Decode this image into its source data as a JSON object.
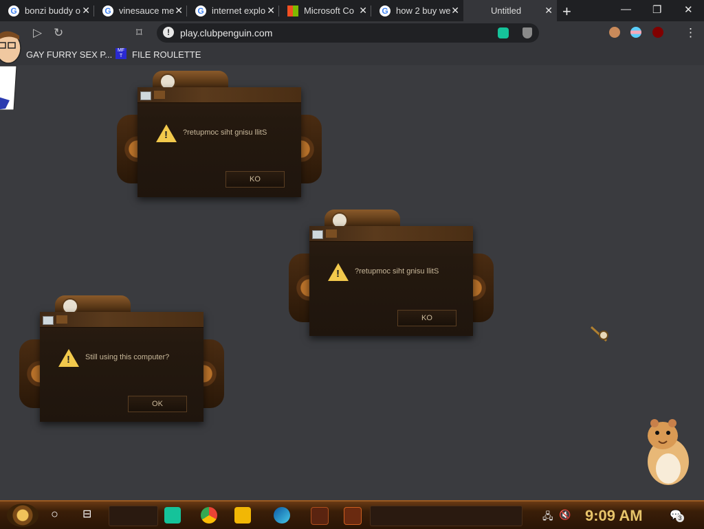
{
  "browser": {
    "tabs": [
      {
        "title": "bonzi buddy o",
        "close": "✕"
      },
      {
        "title": "vinesauce me",
        "close": "✕"
      },
      {
        "title": "internet explo",
        "close": "✕"
      },
      {
        "title": "Microsoft Co",
        "close": "✕"
      },
      {
        "title": "how 2 buy we",
        "close": "✕"
      },
      {
        "title": "Untitled",
        "close": "✕"
      }
    ],
    "new_tab": "+",
    "window_controls": {
      "minimize": "—",
      "maximize": "❐",
      "close": "✕"
    },
    "url": "play.clubpenguin.com",
    "security_icon": "!",
    "bookmarks": [
      {
        "label": "GAY FURRY SEX P..."
      },
      {
        "label": "FILE ROULETTE",
        "icon_text": "MF T"
      }
    ]
  },
  "dialogs": [
    {
      "message": "?retupmoc siht gnisu llitS",
      "button": "KO"
    },
    {
      "message": "?retupmoc siht gnisu llitS",
      "button": "KO"
    },
    {
      "message": "Still using this computer?",
      "button": "OK"
    }
  ],
  "taskbar": {
    "time": "9:09 AM",
    "notification_count": "3",
    "apps": [
      "start-orb",
      "search",
      "task-view",
      "chat",
      "chrome",
      "file-explorer",
      "edge",
      "game",
      "app"
    ]
  },
  "colors": {
    "desktop": "#3a3b3f",
    "dialog_bg": "#24190f",
    "clock": "#e7c46a",
    "warning": "#f2c94c"
  }
}
